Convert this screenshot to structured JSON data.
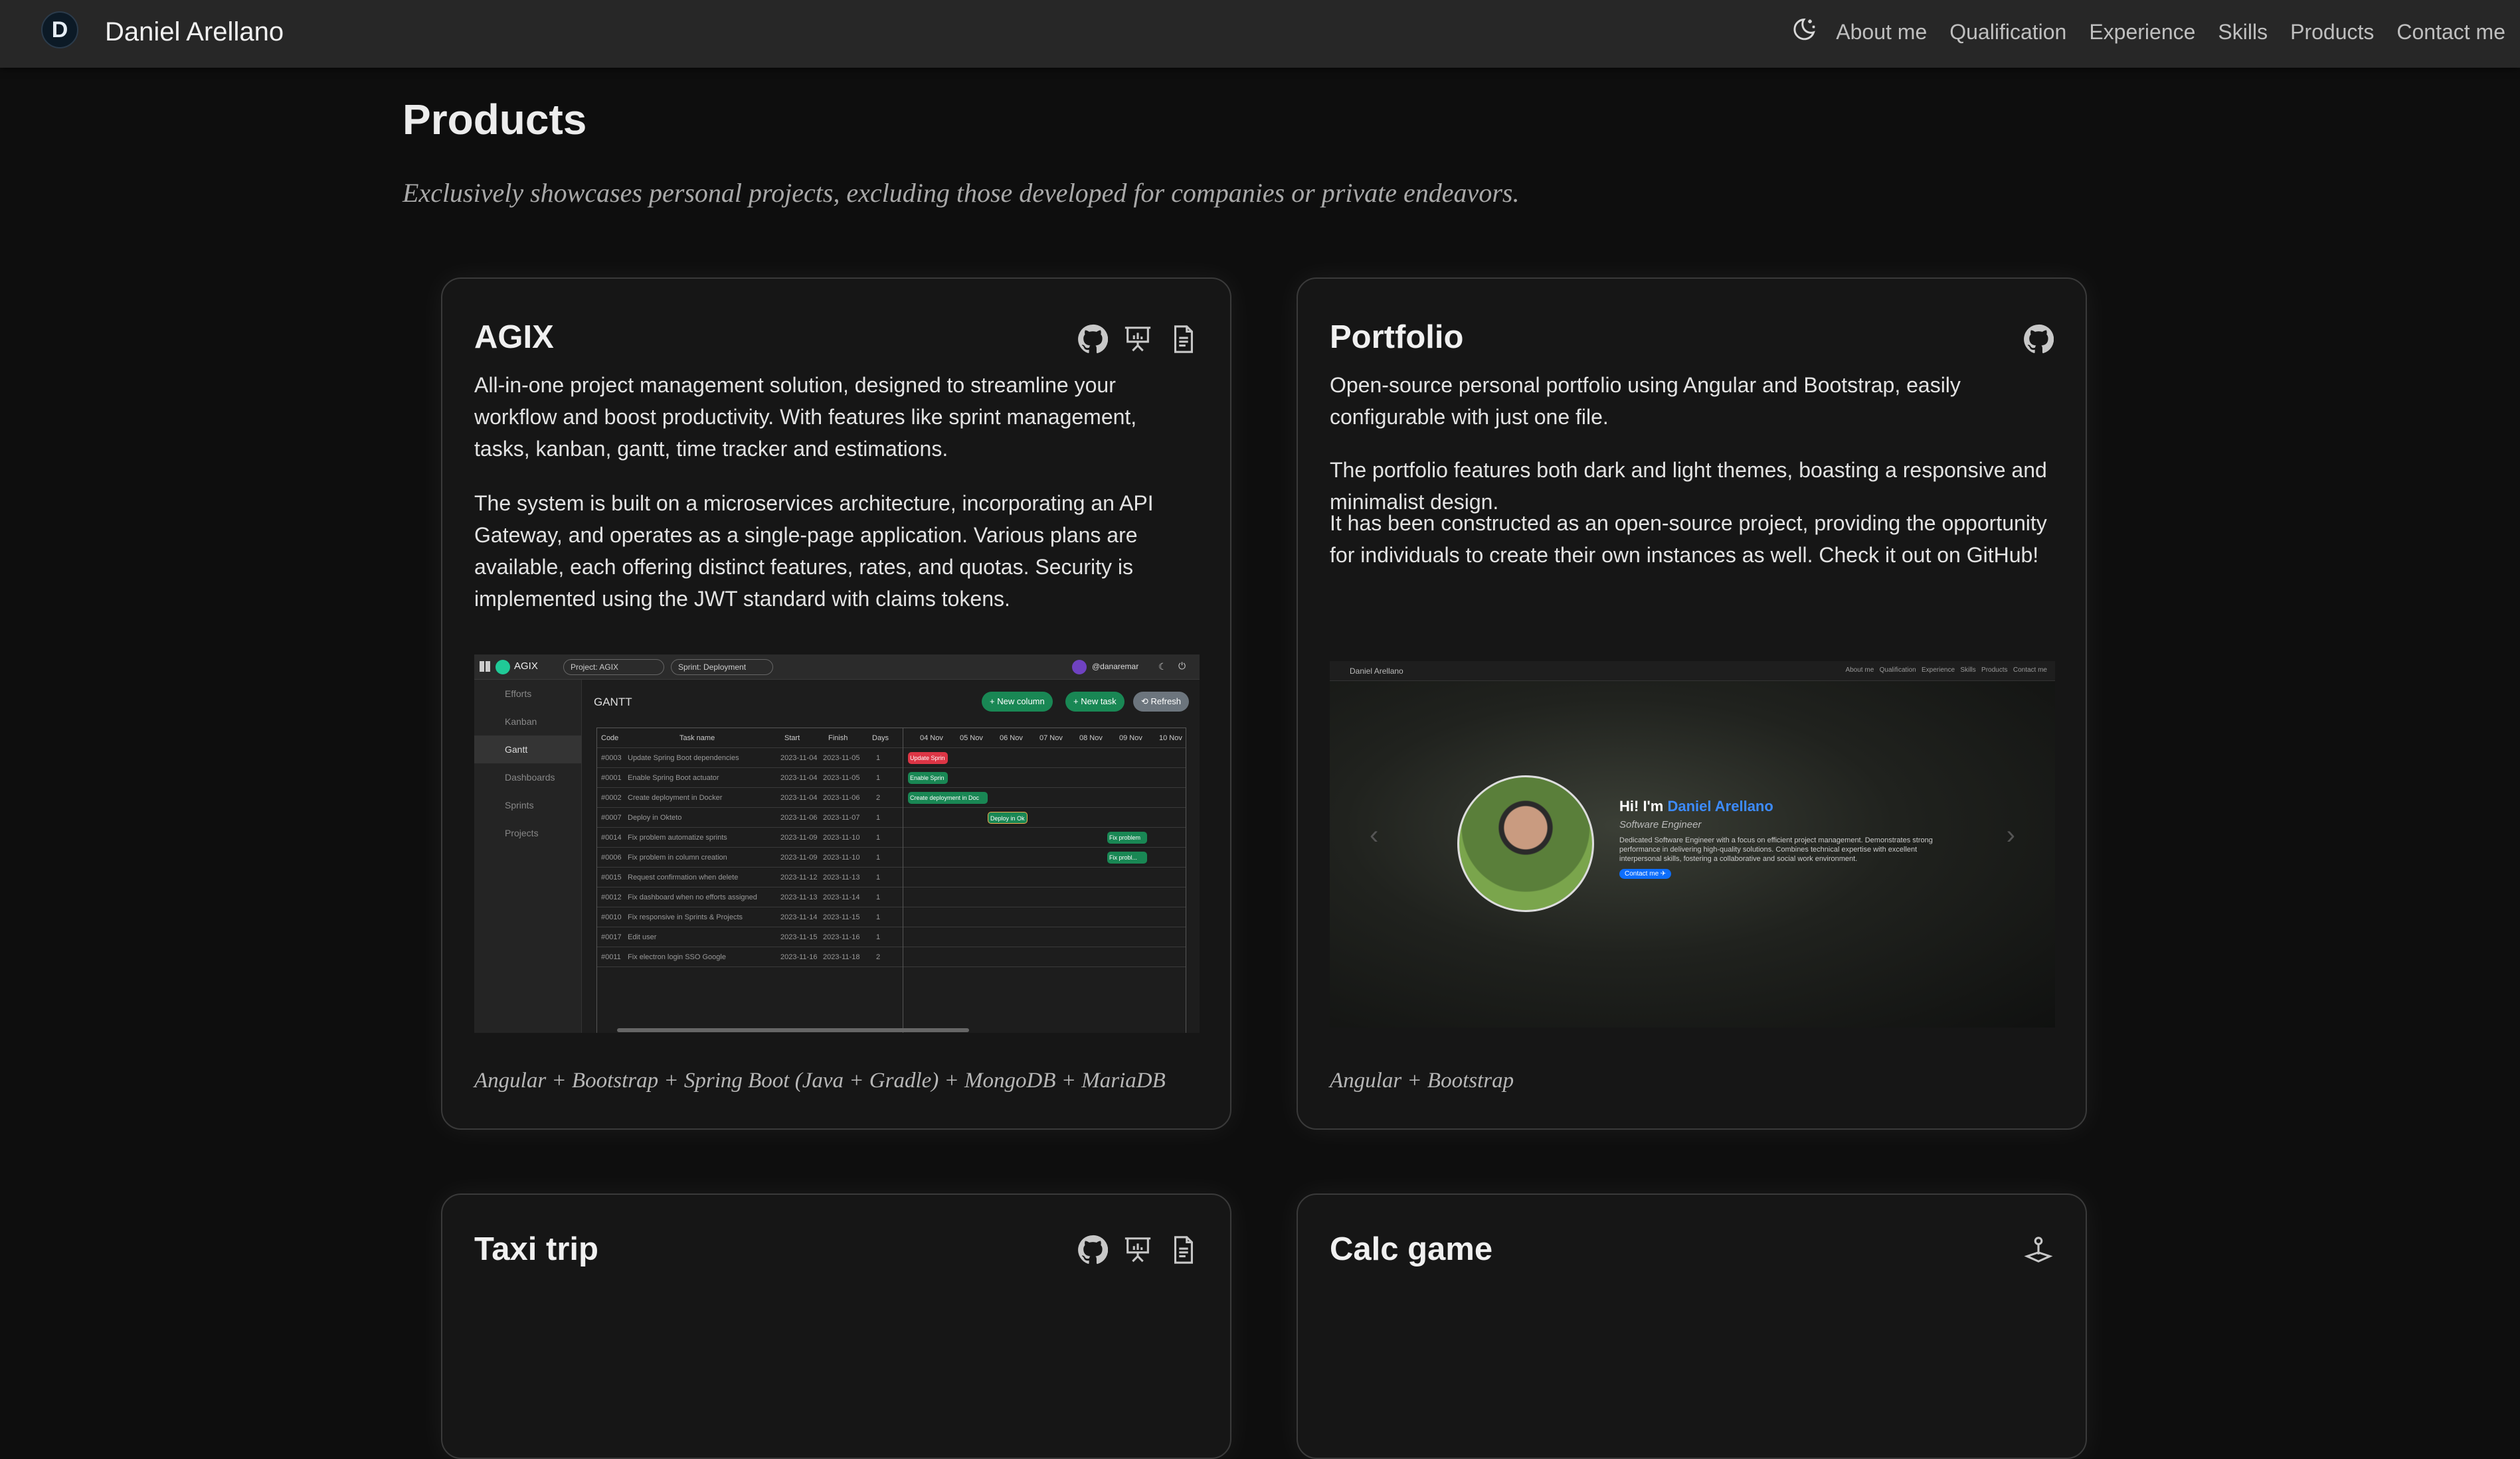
{
  "navbar": {
    "brand_initials": "D",
    "brand_name": "Daniel Arellano",
    "theme_icon": "moon-stars-icon",
    "links": [
      "About me",
      "Qualification",
      "Experience",
      "Skills",
      "Products",
      "Contact me"
    ]
  },
  "products": {
    "title": "Products",
    "subtitle": "Exclusively showcases personal projects, excluding those developed for companies or private endeavors.",
    "cards": [
      {
        "title": "AGIX",
        "icons": [
          "github-icon",
          "presentation-icon",
          "document-icon"
        ],
        "paragraphs": [
          "All-in-one project management solution, designed to streamline your workflow and boost productivity. With features like sprint management, tasks, kanban, gantt, time tracker and estimations.",
          "The system is built on a microservices architecture, incorporating an API Gateway, and operates as a single-page application. Various plans are available, each offering distinct features, rates, and quotas. Security is implemented using the JWT standard with claims tokens."
        ],
        "tech": "Angular + Bootstrap + Spring Boot (Java + Gradle) + MongoDB + MariaDB",
        "screenshot": {
          "app_name": "AGIX",
          "project_select": "Project: AGIX",
          "sprint_select": "Sprint: Deployment",
          "user": "@danaremar",
          "sidebar": [
            "Efforts",
            "Kanban",
            "Gantt",
            "Dashboards",
            "Sprints",
            "Projects"
          ],
          "view_title": "GANTT",
          "buttons": [
            "+ New column",
            "+ New task",
            "⟲ Refresh"
          ],
          "columns": [
            "Code",
            "Task name",
            "Start",
            "Finish",
            "Days"
          ],
          "dates": [
            "04 Nov",
            "05 Nov",
            "06 Nov",
            "07 Nov",
            "08 Nov",
            "09 Nov",
            "10 Nov"
          ],
          "rows": [
            [
              "#0003",
              "Update Spring Boot dependencies",
              "2023-11-04",
              "2023-11-05",
              "1"
            ],
            [
              "#0001",
              "Enable Spring Boot actuator",
              "2023-11-04",
              "2023-11-05",
              "1"
            ],
            [
              "#0002",
              "Create deployment in Docker",
              "2023-11-04",
              "2023-11-06",
              "2"
            ],
            [
              "#0007",
              "Deploy in Okteto",
              "2023-11-06",
              "2023-11-07",
              "1"
            ],
            [
              "#0014",
              "Fix problem automatize sprints",
              "2023-11-09",
              "2023-11-10",
              "1"
            ],
            [
              "#0006",
              "Fix problem in column creation",
              "2023-11-09",
              "2023-11-10",
              "1"
            ],
            [
              "#0015",
              "Request confirmation when delete",
              "2023-11-12",
              "2023-11-13",
              "1"
            ],
            [
              "#0012",
              "Fix dashboard when no efforts assigned",
              "2023-11-13",
              "2023-11-14",
              "1"
            ],
            [
              "#0010",
              "Fix responsive in Sprints & Projects",
              "2023-11-14",
              "2023-11-15",
              "1"
            ],
            [
              "#0017",
              "Edit user",
              "2023-11-15",
              "2023-11-16",
              "1"
            ],
            [
              "#0011",
              "Fix electron login SSO Google",
              "2023-11-16",
              "2023-11-18",
              "2"
            ]
          ],
          "bar_labels": [
            "Update Sprin",
            "Enable Sprin",
            "Create deployment in Doc",
            "Deploy in Ok",
            "Fix problem",
            "Fix probl..."
          ]
        }
      },
      {
        "title": "Portfolio",
        "icons": [
          "github-icon"
        ],
        "paragraphs": [
          "Open-source personal portfolio using Angular and Bootstrap, easily configurable with just one file.",
          "The portfolio features both dark and light themes, boasting a responsive and minimalist design.",
          "It has been constructed as an open-source project, providing the opportunity for individuals to create their own instances as well. Check it out on GitHub!"
        ],
        "tech": "Angular + Bootstrap",
        "screenshot": {
          "brand": "Daniel Arellano",
          "nav": [
            "About me",
            "Qualification",
            "Experience",
            "Skills",
            "Products",
            "Contact me"
          ],
          "greeting": "Hi! I'm",
          "name": "Daniel Arellano",
          "role": "Software Engineer",
          "bio": "Dedicated Software Engineer with a focus on efficient project management. Demonstrates strong performance in delivering high-quality solutions. Combines technical expertise with excellent interpersonal skills, fostering a collaborative and social work environment.",
          "contact_button": "Contact me ✈"
        }
      },
      {
        "title": "Taxi trip",
        "icons": [
          "github-icon",
          "presentation-icon",
          "document-icon"
        ]
      },
      {
        "title": "Calc game",
        "icons": [
          "joystick-icon"
        ]
      }
    ]
  },
  "colors": {
    "background": "#0e0e0e",
    "navbar": "#272727",
    "card": "#161616",
    "accent_blue": "#3d8bfd",
    "gantt_green": "#198754",
    "gantt_red": "#dc3545"
  }
}
